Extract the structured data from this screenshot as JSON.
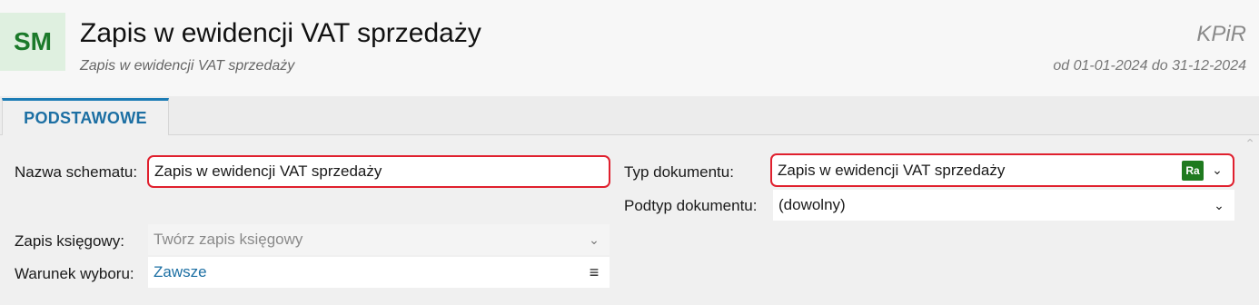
{
  "header": {
    "badge": "SM",
    "title": "Zapis w ewidencji VAT sprzedaży",
    "subtitle": "Zapis w ewidencji VAT sprzedaży",
    "module": "KPiR",
    "period": "od 01-01-2024 do 31-12-2024"
  },
  "tabs": [
    {
      "label": "PODSTAWOWE",
      "active": true
    }
  ],
  "form": {
    "scheme_name": {
      "label": "Nazwa schematu:",
      "value": "Zapis w ewidencji VAT sprzedaży"
    },
    "accounting_entry": {
      "label": "Zapis księgowy:",
      "value": "Twórz zapis księgowy"
    },
    "selection_condition": {
      "label": "Warunek wyboru:",
      "value": "Zawsze"
    },
    "document_type": {
      "label": "Typ dokumentu:",
      "value": "Zapis w ewidencji VAT sprzedaży",
      "badge": "Ra"
    },
    "document_subtype": {
      "label": "Podtyp dokumentu:",
      "value": "(dowolny)"
    }
  },
  "icons": {
    "dropdown": "chevron-down-icon",
    "menu": "hamburger-menu-icon",
    "scroll": "chevron-up-icon"
  },
  "colors": {
    "accent": "#1c6fa3",
    "highlight": "#e0202e",
    "badge_bg": "#dff0e0",
    "badge_text": "#1b7a2a",
    "ra_bg": "#1f7a1f"
  }
}
